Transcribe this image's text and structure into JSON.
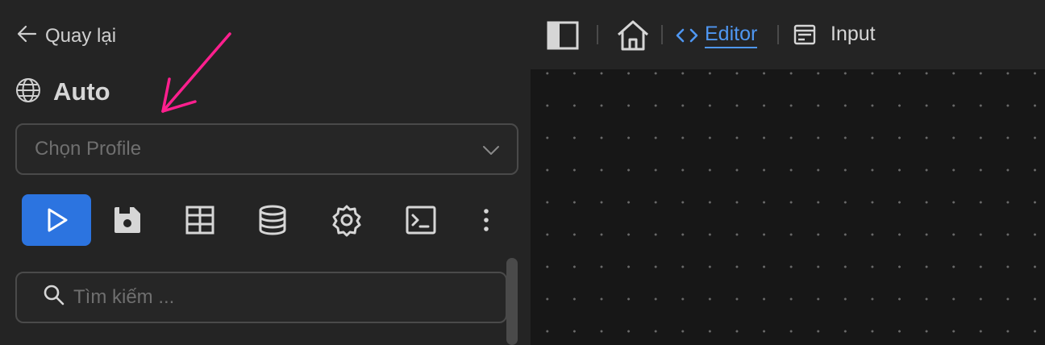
{
  "sidebar": {
    "back_label": "Quay lại",
    "workspace_name": "Auto",
    "profile_placeholder": "Chọn Profile",
    "search_placeholder": "Tìm kiếm ...",
    "toolbar_icons": [
      "play-icon",
      "save-icon",
      "table-icon",
      "database-icon",
      "settings-icon",
      "terminal-icon",
      "more-vertical-icon"
    ]
  },
  "topbar": {
    "tabs": [
      {
        "label": "Editor",
        "icon": "code-icon",
        "active": true
      },
      {
        "label": "Input",
        "icon": "form-icon",
        "active": false
      }
    ]
  },
  "colors": {
    "accent": "#2c74e0",
    "active_tab": "#4f97f2",
    "annotation_arrow": "#ff1f8e",
    "canvas_bg": "#171717",
    "panel_bg": "#242424"
  }
}
